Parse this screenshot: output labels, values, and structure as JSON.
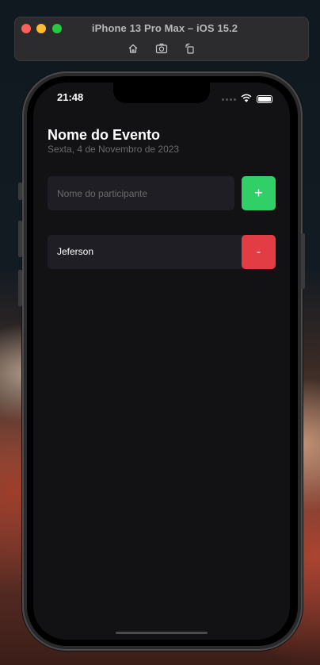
{
  "simulator": {
    "title": "iPhone 13 Pro Max – iOS 15.2",
    "icons": [
      "home-icon",
      "screenshot-icon",
      "rotate-icon"
    ]
  },
  "status_bar": {
    "time": "21:48"
  },
  "event": {
    "title": "Nome do Evento",
    "date": "Sexta, 4 de Novembro de 2023"
  },
  "form": {
    "input_placeholder": "Nome do participante",
    "input_value": "",
    "add_label": "+"
  },
  "participants": [
    {
      "name": "Jeferson",
      "remove_label": "-"
    }
  ],
  "colors": {
    "background": "#121214",
    "field": "#1f1e25",
    "add": "#31cf67",
    "remove": "#e23c44"
  }
}
